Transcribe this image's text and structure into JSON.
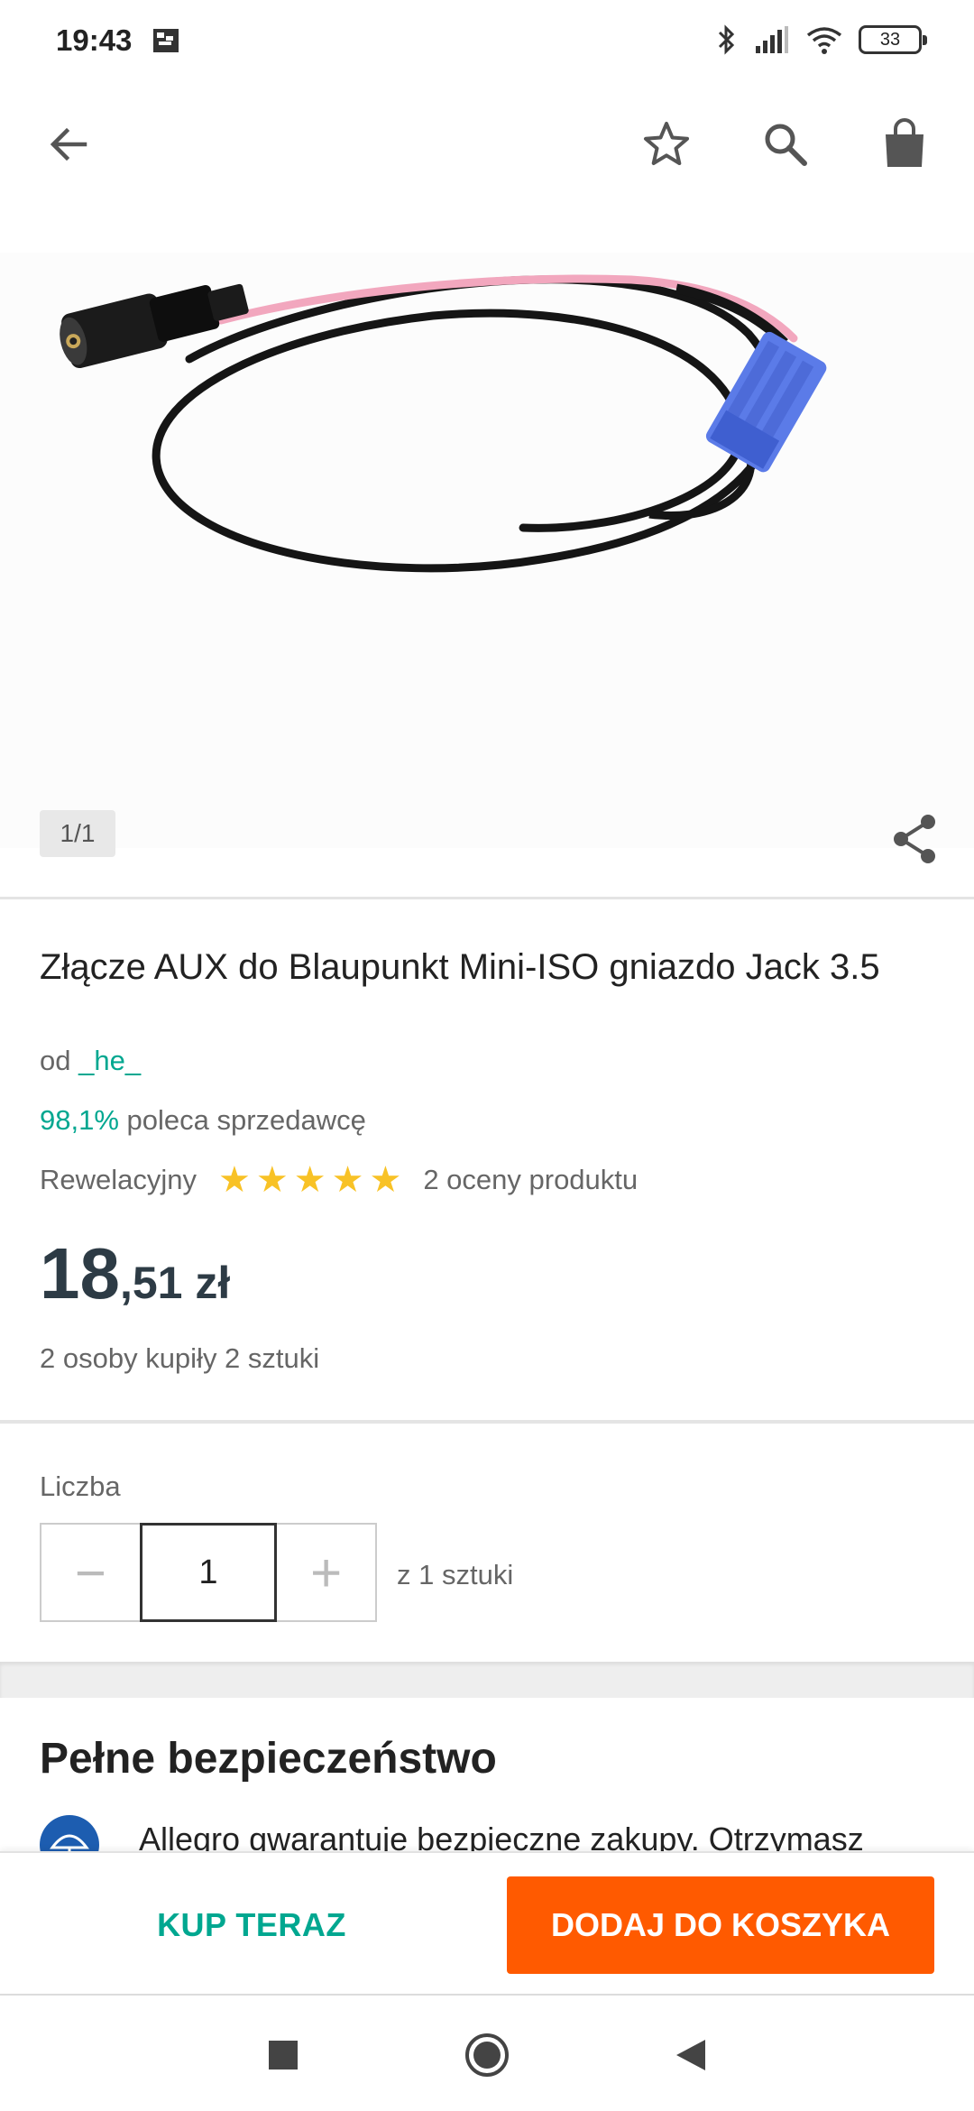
{
  "status_bar": {
    "time": "19:43",
    "battery": "33"
  },
  "app_bar": {
    "icons": [
      "back-arrow-icon",
      "star-outline-icon",
      "search-icon",
      "shopping-bag-icon"
    ]
  },
  "gallery": {
    "counter": "1/1"
  },
  "product": {
    "title": "Złącze AUX do Blaupunkt Mini-ISO gniazdo Jack 3.5",
    "seller_prefix": "od",
    "seller_name": "_he_",
    "recommend_pct": "98,1%",
    "recommend_text": "poleca sprzedawcę",
    "rating_label": "Rewelacyjny",
    "stars": 5,
    "ratings_count": "2 oceny produktu",
    "price_int": "18",
    "price_dec": ",51 zł",
    "bought": "2 osoby kupiły 2 sztuki"
  },
  "quantity": {
    "label": "Liczba",
    "value": "1",
    "minus": "−",
    "plus": "+",
    "of_text": "z 1 sztuki"
  },
  "safety": {
    "title": "Pełne bezpieczeństwo",
    "text": "Allegro gwarantuje bezpieczne zakupy. Otrzymasz"
  },
  "actions": {
    "buy_now": "KUP TERAZ",
    "add_to_cart": "DODAJ DO KOSZYKA"
  },
  "colors": {
    "accent": "#00a790",
    "cta": "#ff5a00",
    "star": "#f8c226"
  }
}
